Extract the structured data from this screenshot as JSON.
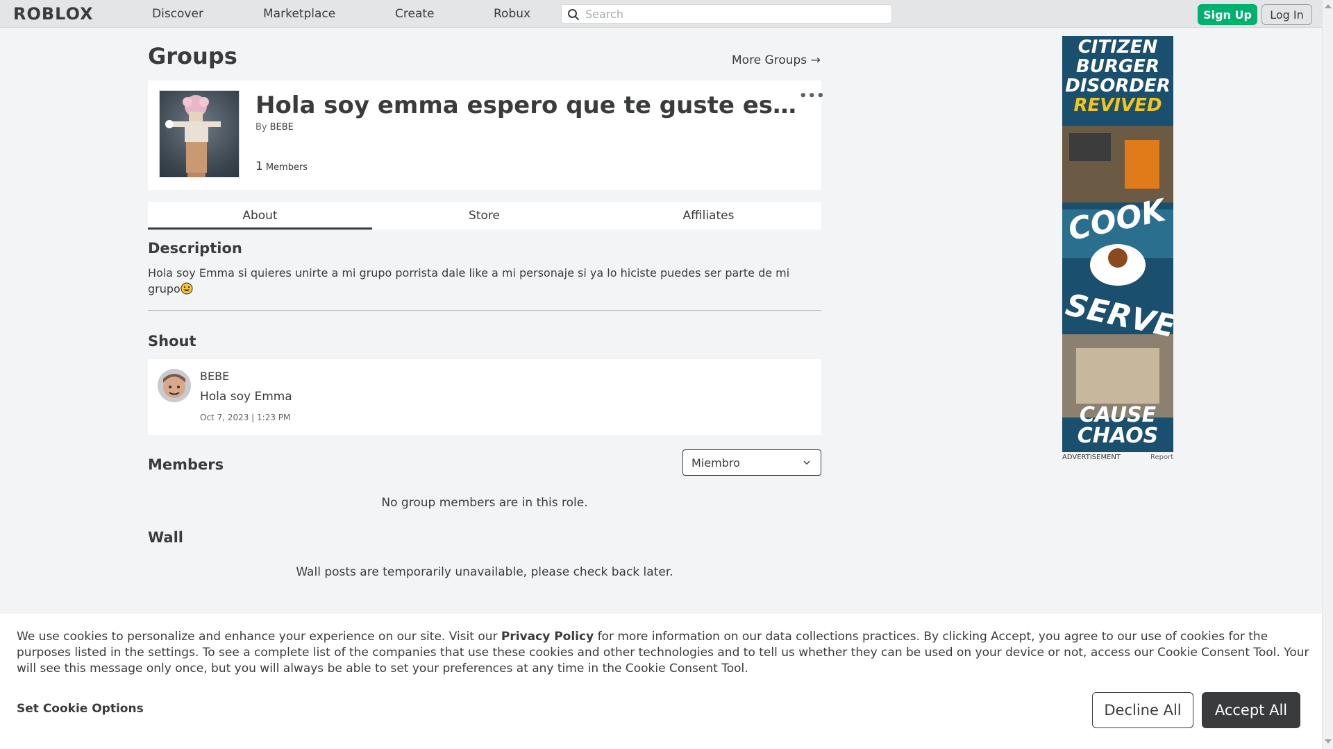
{
  "nav": {
    "logo": "RΟBLOX",
    "links": [
      "Discover",
      "Marketplace",
      "Create",
      "Robux"
    ],
    "search_placeholder": "Search",
    "signup_label": "Sign Up",
    "login_label": "Log In"
  },
  "page": {
    "title": "Groups",
    "more_groups": "More Groups →"
  },
  "group": {
    "name": "Hola soy emma espero que te guste este gr...",
    "by_label": "By",
    "owner": "BEBE",
    "member_count": "1",
    "members_label": "Members",
    "menu_glyph": "•••"
  },
  "tabs": [
    {
      "label": "About",
      "active": true
    },
    {
      "label": "Store",
      "active": false
    },
    {
      "label": "Affiliates",
      "active": false
    }
  ],
  "description": {
    "heading": "Description",
    "text": "Hola soy Emma si quieres unirte a mi grupo porrista dale like a mi personaje si ya lo hiciste puedes ser parte de mi grupo"
  },
  "shout": {
    "heading": "Shout",
    "user": "BEBE",
    "text": "Hola soy Emma",
    "date": "Oct 7, 2023 | 1:23 PM"
  },
  "members": {
    "heading": "Members",
    "role_selected": "Miembro",
    "empty_message": "No group members are in this role."
  },
  "wall": {
    "heading": "Wall",
    "message": "Wall posts are temporarily unavailable, please check back later."
  },
  "ad": {
    "label": "ADVERTISEMENT",
    "report": "Report",
    "headline_lines": [
      "CITIZEN",
      "BURGER",
      "DISORDER"
    ],
    "revived": "REVIVED",
    "cook": "COOK",
    "serve": "SERVE",
    "cause_chaos_lines": [
      "CAUSE",
      "CHAOS"
    ]
  },
  "cookie": {
    "text_before": "We use cookies to personalize and enhance your experience on our site. Visit our ",
    "privacy_link": "Privacy Policy",
    "text_after": " for more information on our data collections practices. By clicking Accept, you agree to our use of cookies for the purposes listed in the settings. To see a complete list of the companies that use these cookies and other technologies and to tell us whether they can be used on your device or not, access our Cookie Consent Tool. Your will see this message only once, but you will always be able to set your preferences at any time in the Cookie Consent Tool.",
    "set_options": "Set Cookie Options",
    "decline": "Decline All",
    "accept": "Accept All"
  },
  "colors": {
    "signup_green": "#00b06f",
    "text_dark": "#393b3d",
    "page_bg": "#f2f4f5",
    "ad_bg": "#1b4f6e",
    "ad_yellow": "#f5c518"
  }
}
